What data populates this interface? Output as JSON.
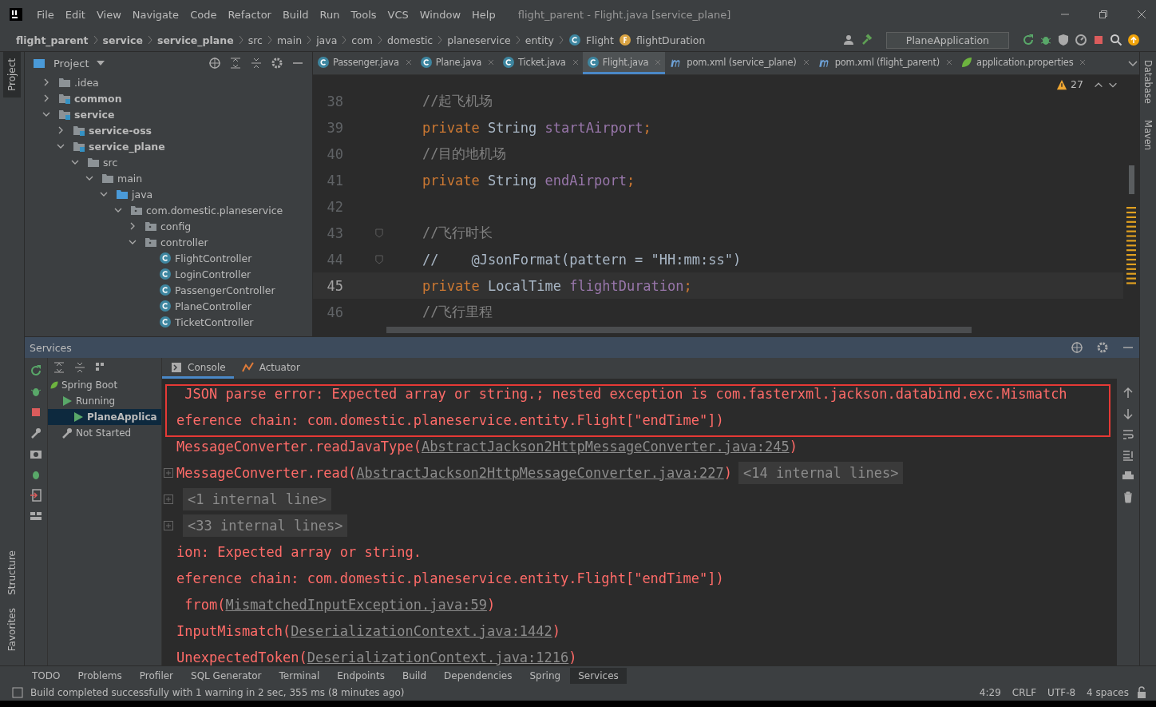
{
  "window": {
    "title": "flight_parent - Flight.java [service_plane]"
  },
  "menu": [
    "File",
    "Edit",
    "View",
    "Navigate",
    "Code",
    "Refactor",
    "Build",
    "Run",
    "Tools",
    "VCS",
    "Window",
    "Help"
  ],
  "breadcrumb": [
    {
      "label": "flight_parent",
      "kind": "module"
    },
    {
      "label": "service",
      "kind": "module"
    },
    {
      "label": "service_plane",
      "kind": "module"
    },
    {
      "label": "src",
      "kind": "dir"
    },
    {
      "label": "main",
      "kind": "dir"
    },
    {
      "label": "java",
      "kind": "dir"
    },
    {
      "label": "com",
      "kind": "dir"
    },
    {
      "label": "domestic",
      "kind": "dir"
    },
    {
      "label": "planeservice",
      "kind": "dir"
    },
    {
      "label": "entity",
      "kind": "dir"
    },
    {
      "label": "Flight",
      "kind": "class"
    },
    {
      "label": "flightDuration",
      "kind": "field"
    }
  ],
  "run_config": "PlaneApplication",
  "left_stripe": [
    {
      "label": "Project",
      "selected": true
    },
    {
      "label": "Structure",
      "selected": false
    },
    {
      "label": "Favorites",
      "selected": false
    }
  ],
  "right_stripe": [
    "Database",
    "Maven"
  ],
  "project_panel": {
    "title": "Project",
    "items": [
      {
        "label": ".idea",
        "kind": "folder",
        "expanded": false
      },
      {
        "label": "common",
        "kind": "module",
        "expanded": false
      },
      {
        "label": "service",
        "kind": "module",
        "expanded": true,
        "children": [
          {
            "label": "service-oss",
            "kind": "module",
            "expanded": false
          },
          {
            "label": "service_plane",
            "kind": "module",
            "expanded": true,
            "children": [
              {
                "label": "src",
                "kind": "folder",
                "expanded": true,
                "children": [
                  {
                    "label": "main",
                    "kind": "folder",
                    "expanded": true,
                    "children": [
                      {
                        "label": "java",
                        "kind": "source",
                        "expanded": true,
                        "children": [
                          {
                            "label": "com.domestic.planeservice",
                            "kind": "package",
                            "expanded": true,
                            "children": [
                              {
                                "label": "config",
                                "kind": "package",
                                "expanded": false
                              },
                              {
                                "label": "controller",
                                "kind": "package",
                                "expanded": true,
                                "children": [
                                  {
                                    "label": "FlightController",
                                    "kind": "class"
                                  },
                                  {
                                    "label": "LoginController",
                                    "kind": "class"
                                  },
                                  {
                                    "label": "PassengerController",
                                    "kind": "class"
                                  },
                                  {
                                    "label": "PlaneController",
                                    "kind": "class"
                                  },
                                  {
                                    "label": "TicketController",
                                    "kind": "class"
                                  }
                                ]
                              }
                            ]
                          }
                        ]
                      }
                    ]
                  }
                ]
              }
            ]
          }
        ]
      }
    ]
  },
  "editor_tabs": [
    {
      "label": "Passenger.java",
      "kind": "class",
      "selected": false
    },
    {
      "label": "Plane.java",
      "kind": "class",
      "selected": false
    },
    {
      "label": "Ticket.java",
      "kind": "class",
      "selected": false
    },
    {
      "label": "Flight.java",
      "kind": "class",
      "selected": true
    },
    {
      "label": "pom.xml (service_plane)",
      "kind": "maven",
      "selected": false
    },
    {
      "label": "pom.xml (flight_parent)",
      "kind": "maven",
      "selected": false
    },
    {
      "label": "application.properties",
      "kind": "spring",
      "selected": false
    }
  ],
  "warning_count": "27",
  "code_lines": [
    {
      "number": "38",
      "current": false,
      "fold": false,
      "tokens": [
        {
          "kind": "comment",
          "text": "//起飞机场"
        }
      ]
    },
    {
      "number": "39",
      "current": false,
      "fold": false,
      "tokens": [
        {
          "kind": "keyword",
          "text": "private "
        },
        {
          "kind": "type",
          "text": "String "
        },
        {
          "kind": "field",
          "text": "startAirport"
        },
        {
          "kind": "keyword",
          "text": ";"
        }
      ]
    },
    {
      "number": "40",
      "current": false,
      "fold": false,
      "tokens": [
        {
          "kind": "comment",
          "text": "//目的地机场"
        }
      ]
    },
    {
      "number": "41",
      "current": false,
      "fold": false,
      "tokens": [
        {
          "kind": "keyword",
          "text": "private "
        },
        {
          "kind": "type",
          "text": "String "
        },
        {
          "kind": "field",
          "text": "endAirport"
        },
        {
          "kind": "keyword",
          "text": ";"
        }
      ]
    },
    {
      "number": "42",
      "current": false,
      "fold": false
    },
    {
      "number": "43",
      "current": false,
      "fold": true,
      "tokens": [
        {
          "kind": "comment",
          "text": "//飞行时长"
        }
      ]
    },
    {
      "number": "44",
      "current": false,
      "fold": true,
      "tokens": [
        {
          "kind": "type",
          "text": "//    @JsonFormat(pattern = \"HH:mm:ss\")"
        }
      ]
    },
    {
      "number": "45",
      "current": true,
      "fold": false,
      "tokens": [
        {
          "kind": "keyword",
          "text": "private "
        },
        {
          "kind": "type",
          "text": "LocalTime "
        },
        {
          "kind": "field",
          "text": "flightDuration"
        },
        {
          "kind": "keyword",
          "text": ";"
        }
      ]
    },
    {
      "number": "46",
      "current": false,
      "fold": false,
      "tokens": [
        {
          "kind": "comment",
          "text": "//飞行里程"
        }
      ]
    }
  ],
  "services": {
    "title": "Services",
    "tree": [
      {
        "label": "Spring Boot",
        "kind": "spring",
        "selected": false,
        "children": [
          {
            "label": "Running",
            "kind": "run",
            "selected": false,
            "children": [
              {
                "label": "PlaneApplica",
                "kind": "run",
                "selected": true
              }
            ]
          },
          {
            "label": "Not Started",
            "kind": "wrench",
            "selected": false
          }
        ]
      }
    ],
    "console_tabs": [
      {
        "label": "Console",
        "selected": true
      },
      {
        "label": "Actuator",
        "selected": false
      }
    ],
    "console_lines": [
      {
        "foldable": false,
        "segments": [
          {
            "kind": "text",
            "text": " JSON parse error: Expected array or string.; nested exception is com.fasterxml.jackson.databind.exc.Mismatch"
          }
        ]
      },
      {
        "foldable": false,
        "segments": [
          {
            "kind": "text",
            "text": "eference chain: com.domestic.planeservice.entity.Flight[\"endTime\"])"
          }
        ]
      },
      {
        "foldable": false,
        "segments": [
          {
            "kind": "text",
            "text": "MessageConverter.readJavaType("
          },
          {
            "kind": "link",
            "text": "AbstractJackson2HttpMessageConverter.java:245"
          },
          {
            "kind": "text",
            "text": ")"
          }
        ]
      },
      {
        "foldable": true,
        "segments": [
          {
            "kind": "text",
            "text": "MessageConverter.read("
          },
          {
            "kind": "link",
            "text": "AbstractJackson2HttpMessageConverter.java:227"
          },
          {
            "kind": "text",
            "text": ")"
          },
          {
            "kind": "folded",
            "text": "<14 internal lines>"
          }
        ]
      },
      {
        "foldable": true,
        "segments": [
          {
            "kind": "folded",
            "text": "<1 internal line>"
          }
        ]
      },
      {
        "foldable": true,
        "segments": [
          {
            "kind": "folded",
            "text": "<33 internal lines>"
          }
        ]
      },
      {
        "foldable": false,
        "segments": [
          {
            "kind": "text",
            "text": "ion: Expected array or string."
          }
        ]
      },
      {
        "foldable": false,
        "segments": [
          {
            "kind": "text",
            "text": "eference chain: com.domestic.planeservice.entity.Flight[\"endTime\"])"
          }
        ]
      },
      {
        "foldable": false,
        "segments": [
          {
            "kind": "text",
            "text": " from("
          },
          {
            "kind": "link",
            "text": "MismatchedInputException.java:59"
          },
          {
            "kind": "text",
            "text": ")"
          }
        ]
      },
      {
        "foldable": false,
        "segments": [
          {
            "kind": "text",
            "text": "InputMismatch("
          },
          {
            "kind": "link",
            "text": "DeserializationContext.java:1442"
          },
          {
            "kind": "text",
            "text": ")"
          }
        ]
      },
      {
        "foldable": false,
        "segments": [
          {
            "kind": "text",
            "text": "UnexpectedToken("
          },
          {
            "kind": "link",
            "text": "DeserializationContext.java:1216"
          },
          {
            "kind": "text",
            "text": ")"
          }
        ]
      }
    ]
  },
  "tool_tabs": [
    {
      "label": "TODO",
      "selected": false
    },
    {
      "label": "Problems",
      "selected": false
    },
    {
      "label": "Profiler",
      "selected": false
    },
    {
      "label": "SQL Generator",
      "selected": false
    },
    {
      "label": "Terminal",
      "selected": false
    },
    {
      "label": "Endpoints",
      "selected": false
    },
    {
      "label": "Build",
      "selected": false
    },
    {
      "label": "Dependencies",
      "selected": false
    },
    {
      "label": "Spring",
      "selected": false
    },
    {
      "label": "Services",
      "selected": true
    }
  ],
  "status_bar": {
    "message": "Build completed successfully with 1 warning in 2 sec, 355 ms (8 minutes ago)",
    "items": [
      "4:29",
      "CRLF",
      "UTF-8",
      "4 spaces"
    ]
  }
}
